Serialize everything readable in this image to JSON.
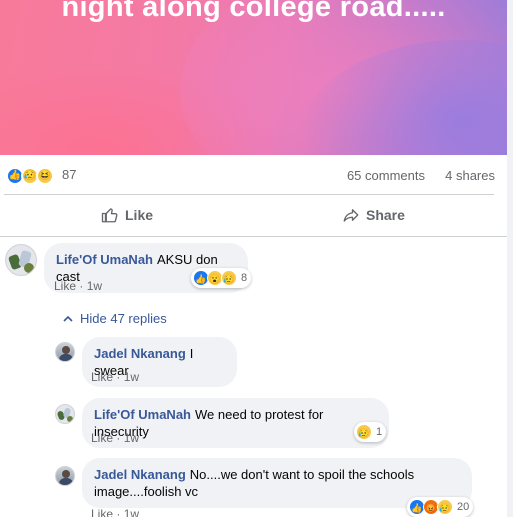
{
  "post": {
    "caption": "night along college road.....",
    "reaction_count": "87",
    "comments": "65 comments",
    "shares": "4 shares"
  },
  "actions": {
    "like_label": "Like",
    "share_label": "Share"
  },
  "comments": [
    {
      "author": "Life'Of UmaNah",
      "text": "AKSU don cast",
      "like_label": "Like",
      "time": "1w",
      "reaction_count": "8"
    }
  ],
  "hide_replies_label": "Hide 47 replies",
  "replies": [
    {
      "author": "Jadel Nkanang",
      "text": "I swear",
      "like_label": "Like",
      "time": "1w"
    },
    {
      "author": "Life'Of UmaNah",
      "text": "We need to protest for insecurity",
      "like_label": "Like",
      "time": "1w",
      "reaction_count": "1"
    },
    {
      "author": "Jadel Nkanang",
      "text": "No....we don't want to spoil the schools image....foolish vc",
      "like_label": "Like",
      "time": "1w",
      "reaction_count": "20"
    }
  ],
  "separator": "·",
  "colors": {
    "link_blue": "#385898",
    "like_blue": "#1877f2",
    "bubble_bg": "#f0f2f5",
    "meta_gray": "#65676b"
  },
  "icons": [
    "like-icon",
    "sad-icon",
    "haha-icon",
    "wow-icon",
    "angry-icon",
    "thumb-up-outline-icon",
    "share-arrow-icon",
    "chevron-up-icon"
  ]
}
